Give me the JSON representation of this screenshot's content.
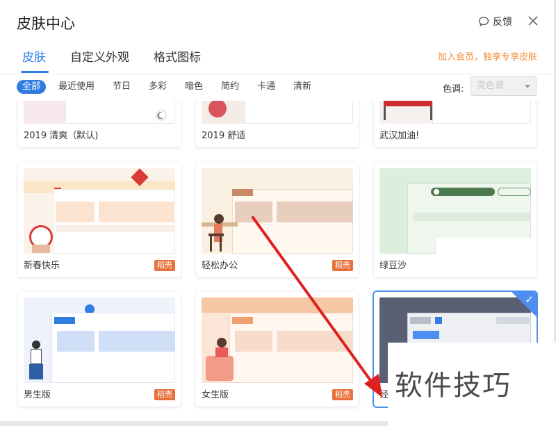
{
  "dialog": {
    "title": "皮肤中心",
    "feedback_label": "反馈",
    "tabs": [
      {
        "label": "皮肤",
        "active": true
      },
      {
        "label": "自定义外观",
        "active": false
      },
      {
        "label": "格式图标",
        "active": false
      }
    ],
    "vip_link": "加入会员，独享专享皮肤"
  },
  "filters": {
    "chips": [
      "全部",
      "最近使用",
      "节日",
      "多彩",
      "暗色",
      "简约",
      "卡通",
      "清新"
    ],
    "active_chip": "全部",
    "tone_label": "色调:",
    "tone_placeholder": "亮色调"
  },
  "skins": [
    {
      "name": "2019 清爽（默认)",
      "badge": "",
      "selected": false
    },
    {
      "name": "2019 舒适",
      "badge": "",
      "selected": false
    },
    {
      "name": "武汉加油!",
      "badge": "",
      "selected": false
    },
    {
      "name": "新春快乐",
      "badge": "稻壳",
      "selected": false
    },
    {
      "name": "轻松办公",
      "badge": "稻壳",
      "selected": false
    },
    {
      "name": "绿豆沙",
      "badge": "",
      "selected": false
    },
    {
      "name": "男生版",
      "badge": "稻壳",
      "selected": false
    },
    {
      "name": "女生版",
      "badge": "稻壳",
      "selected": false
    },
    {
      "name": "经",
      "badge": "",
      "selected": true
    }
  ],
  "watermark": "软件技巧",
  "colors": {
    "accent": "#2f7de1",
    "vip": "#f08c3a",
    "badge": "#e8703a",
    "arrow": "#e02020"
  }
}
